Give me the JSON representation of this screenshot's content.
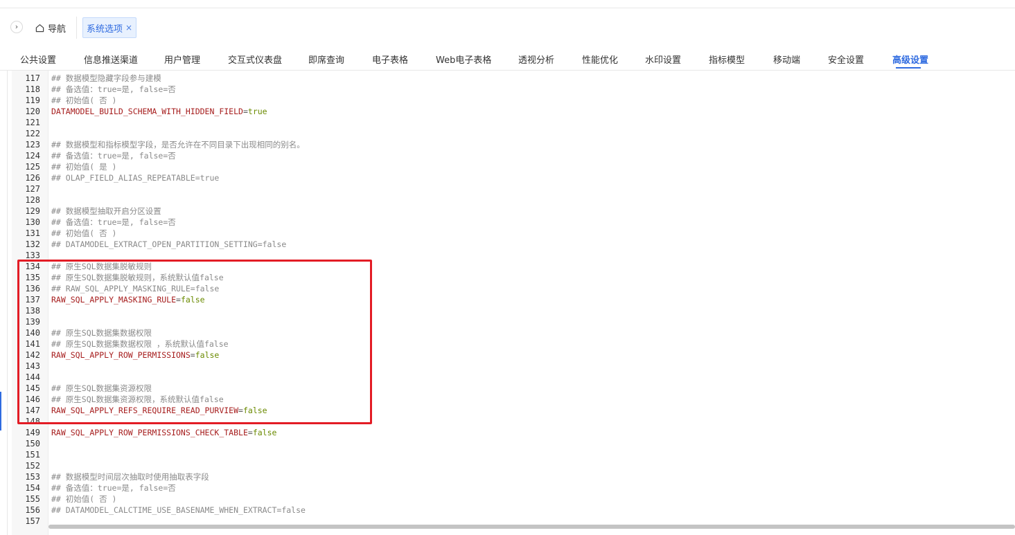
{
  "header": {
    "nav_label": "导航",
    "open_tab": {
      "label": "系统选项",
      "close": "×"
    }
  },
  "menu": {
    "items": [
      "公共设置",
      "信息推送渠道",
      "用户管理",
      "交互式仪表盘",
      "即席查询",
      "电子表格",
      "Web电子表格",
      "透视分析",
      "性能优化",
      "水印设置",
      "指标模型",
      "移动端",
      "安全设置",
      "高级设置"
    ],
    "active": "高级设置"
  },
  "editor": {
    "lines": [
      {
        "n": "117",
        "type": "comment",
        "text": "## 数据模型隐藏字段参与建模"
      },
      {
        "n": "118",
        "type": "comment",
        "text": "## 备选值：true=是, false=否"
      },
      {
        "n": "119",
        "type": "comment",
        "text": "## 初始值( 否 )"
      },
      {
        "n": "120",
        "type": "config",
        "key": "DATAMODEL_BUILD_SCHEMA_WITH_HIDDEN_FIELD",
        "value": "true"
      },
      {
        "n": "121",
        "type": "blank",
        "text": ""
      },
      {
        "n": "122",
        "type": "blank",
        "text": ""
      },
      {
        "n": "123",
        "type": "comment",
        "text": "## 数据模型和指标模型字段，是否允许在不同目录下出现相同的别名。"
      },
      {
        "n": "124",
        "type": "comment",
        "text": "## 备选值：true=是, false=否"
      },
      {
        "n": "125",
        "type": "comment",
        "text": "## 初始值( 是 )"
      },
      {
        "n": "126",
        "type": "comment",
        "text": "## OLAP_FIELD_ALIAS_REPEATABLE=true"
      },
      {
        "n": "127",
        "type": "blank",
        "text": ""
      },
      {
        "n": "128",
        "type": "blank",
        "text": ""
      },
      {
        "n": "129",
        "type": "comment",
        "text": "## 数据模型抽取开启分区设置"
      },
      {
        "n": "130",
        "type": "comment",
        "text": "## 备选值：true=是, false=否"
      },
      {
        "n": "131",
        "type": "comment",
        "text": "## 初始值( 否 )"
      },
      {
        "n": "132",
        "type": "comment",
        "text": "## DATAMODEL_EXTRACT_OPEN_PARTITION_SETTING=false"
      },
      {
        "n": "133",
        "type": "blank",
        "text": ""
      },
      {
        "n": "134",
        "type": "comment",
        "text": "## 原生SQL数据集脱敏规则"
      },
      {
        "n": "135",
        "type": "comment",
        "text": "## 原生SQL数据集脱敏规则，系统默认值false"
      },
      {
        "n": "136",
        "type": "comment",
        "text": "## RAW_SQL_APPLY_MASKING_RULE=false"
      },
      {
        "n": "137",
        "type": "config",
        "key": "RAW_SQL_APPLY_MASKING_RULE",
        "value": "false"
      },
      {
        "n": "138",
        "type": "blank",
        "text": ""
      },
      {
        "n": "139",
        "type": "blank",
        "text": ""
      },
      {
        "n": "140",
        "type": "comment",
        "text": "## 原生SQL数据集数据权限"
      },
      {
        "n": "141",
        "type": "comment",
        "text": "## 原生SQL数据集数据权限 ，系统默认值false"
      },
      {
        "n": "142",
        "type": "config",
        "key": "RAW_SQL_APPLY_ROW_PERMISSIONS",
        "value": "false"
      },
      {
        "n": "143",
        "type": "blank",
        "text": ""
      },
      {
        "n": "144",
        "type": "blank",
        "text": ""
      },
      {
        "n": "145",
        "type": "comment",
        "text": "## 原生SQL数据集资源权限"
      },
      {
        "n": "146",
        "type": "comment",
        "text": "## 原生SQL数据集资源权限，系统默认值false"
      },
      {
        "n": "147",
        "type": "config",
        "key": "RAW_SQL_APPLY_REFS_REQUIRE_READ_PURVIEW",
        "value": "false"
      },
      {
        "n": "148",
        "type": "blank",
        "text": ""
      },
      {
        "n": "149",
        "type": "config",
        "key": "RAW_SQL_APPLY_ROW_PERMISSIONS_CHECK_TABLE",
        "value": "false"
      },
      {
        "n": "150",
        "type": "blank",
        "text": ""
      },
      {
        "n": "151",
        "type": "blank",
        "text": ""
      },
      {
        "n": "152",
        "type": "blank",
        "text": ""
      },
      {
        "n": "153",
        "type": "comment",
        "text": "## 数据模型时间层次抽取时使用抽取表字段"
      },
      {
        "n": "154",
        "type": "comment",
        "text": "## 备选值：true=是, false=否"
      },
      {
        "n": "155",
        "type": "comment",
        "text": "## 初始值( 否 )"
      },
      {
        "n": "156",
        "type": "comment",
        "text": "## DATAMODEL_CALCTIME_USE_BASENAME_WHEN_EXTRACT=false"
      },
      {
        "n": "157",
        "type": "blank",
        "text": ""
      }
    ]
  },
  "colors": {
    "accent": "#2f6be0",
    "highlight_box": "#e31c25",
    "comment": "#8a8a8a",
    "config_key": "#a61d1d",
    "config_value": "#6a8a00"
  },
  "icons": {
    "collapse": "chevron-right-icon",
    "nav": "home-icon",
    "close": "close-icon"
  }
}
